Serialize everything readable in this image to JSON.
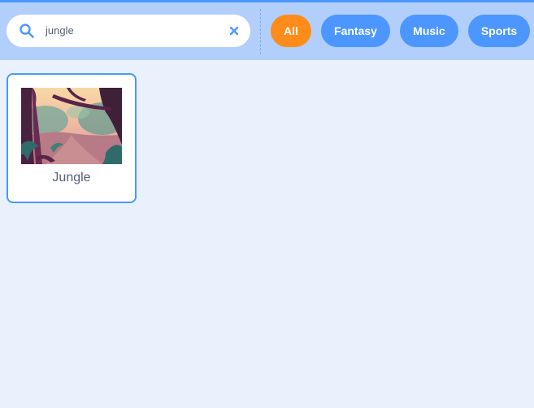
{
  "search": {
    "value": "jungle",
    "icon": "search-icon",
    "clear_icon": "close-icon"
  },
  "tags": [
    {
      "label": "All",
      "selected": true,
      "color": "#ff8c1a"
    },
    {
      "label": "Fantasy",
      "selected": false,
      "color": "#4c97ff"
    },
    {
      "label": "Music",
      "selected": false,
      "color": "#4c97ff"
    },
    {
      "label": "Sports",
      "selected": false,
      "color": "#4c97ff"
    }
  ],
  "results": [
    {
      "name": "Jungle",
      "thumbnail": "jungle-backdrop-image",
      "selected": true
    }
  ],
  "colors": {
    "accent": "#4c97ff",
    "selected_tag": "#ff8c1a",
    "filter_bar": "#b2cffc",
    "background": "#e9f1fc"
  }
}
